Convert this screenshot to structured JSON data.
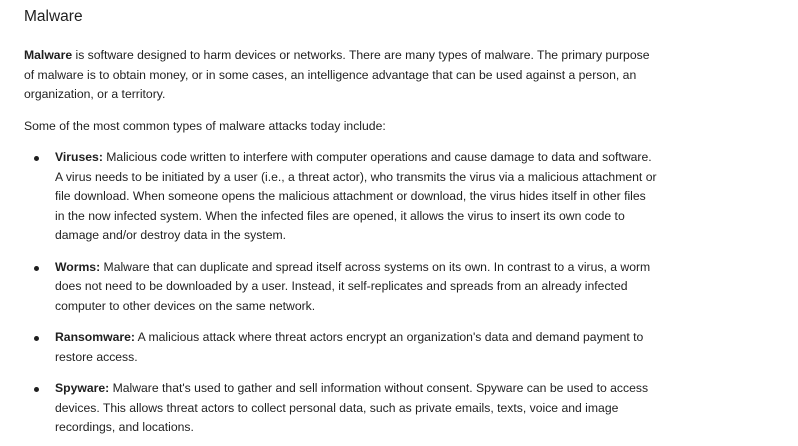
{
  "title": "Malware",
  "intro": {
    "term": "Malware",
    "text": " is software designed to harm devices or networks. There are many types of malware. The primary purpose of malware is to obtain money, or in some cases, an intelligence advantage that can be used against a person, an organization, or a territory."
  },
  "lead": "Some of the most common types of malware attacks today include:",
  "items": [
    {
      "term": "Viruses:",
      "text": " Malicious code written to interfere with computer operations and cause damage to data and software. A virus needs to be initiated by a user (i.e., a threat actor), who transmits the virus via a malicious attachment or file download. When someone opens the malicious attachment or download, the virus hides itself in other files in the now infected system. When the infected files are opened, it allows the virus to insert its own code to damage and/or destroy data in the system."
    },
    {
      "term": "Worms:",
      "text": " Malware that can duplicate and spread itself across systems on its own. In contrast to a virus, a worm does not need to be downloaded by a user. Instead, it self-replicates and spreads from an already infected computer to other devices on the same network."
    },
    {
      "term": "Ransomware:",
      "text": " A malicious attack where threat actors encrypt an organization's data and demand payment to restore access."
    },
    {
      "term": "Spyware:",
      "text": " Malware that's used to gather and sell information without consent. Spyware can be used to access devices. This allows threat actors to collect personal data, such as private emails, texts, voice and image recordings, and locations."
    }
  ]
}
